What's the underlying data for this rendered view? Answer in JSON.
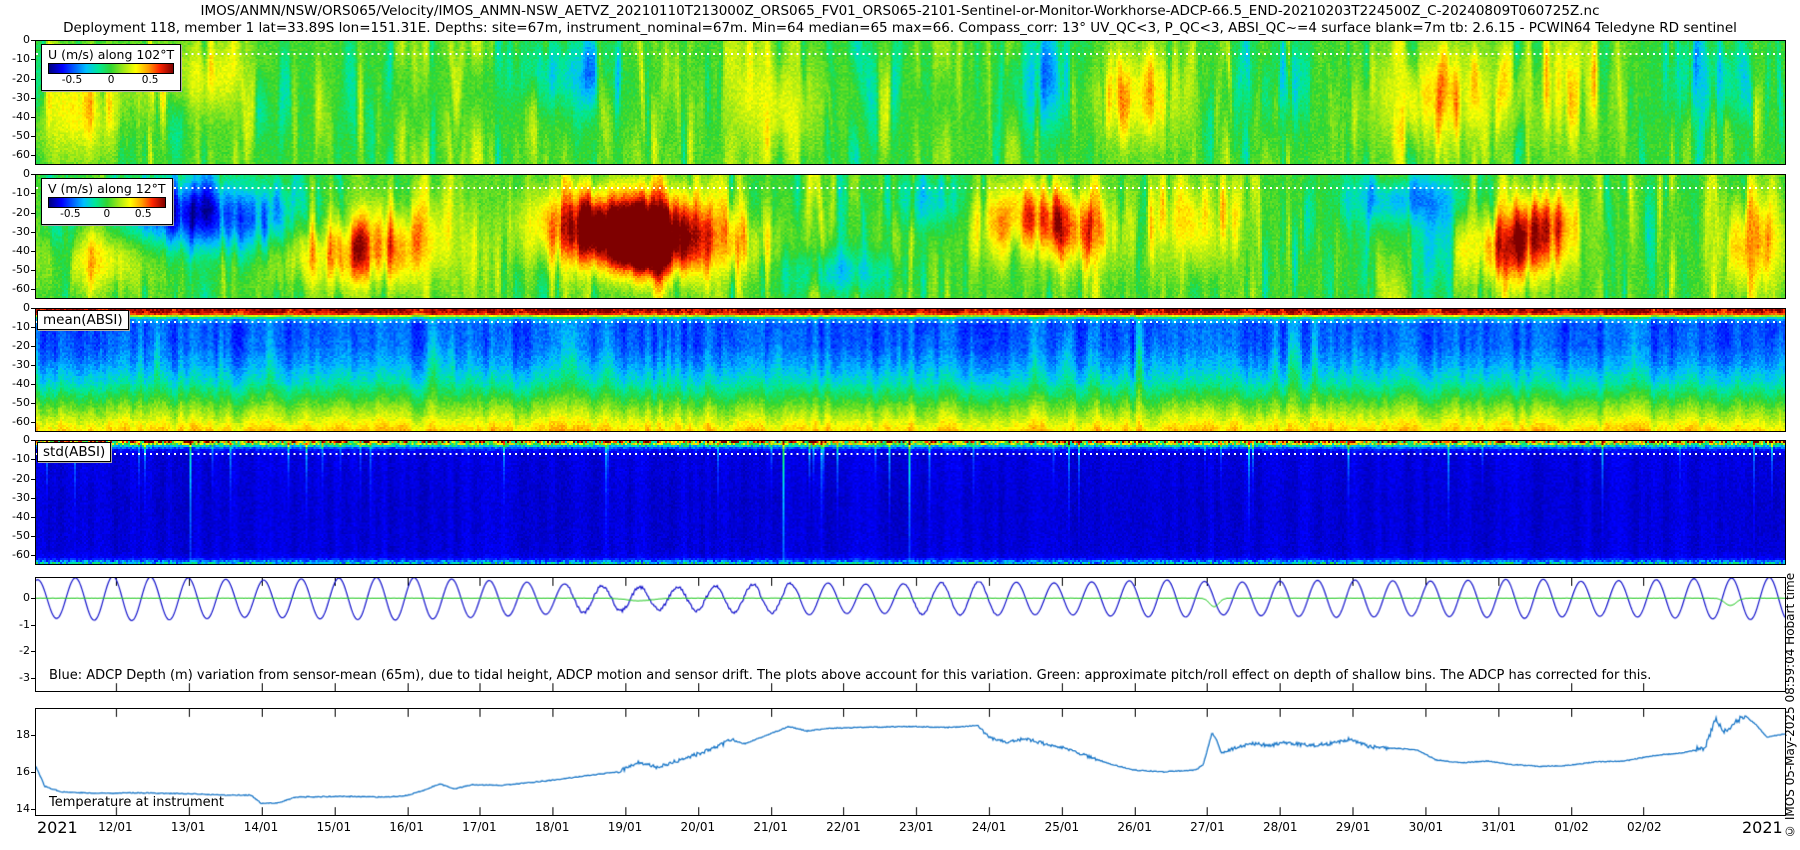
{
  "header": {
    "line1": "IMOS/ANMN/NSW/ORS065/Velocity/IMOS_ANMN-NSW_AETVZ_20210110T213000Z_ORS065_FV01_ORS065-2101-Sentinel-or-Monitor-Workhorse-ADCP-66.5_END-20210203T224500Z_C-20240809T060725Z.nc",
    "line2": "Deployment 118, member 1 lat=33.89S lon=151.31E. Depths: site=67m, instrument_nominal=67m. Min=64 median=65 max=66. Compass_corr: 13° UV_QC<3, P_QC<3, ABSI_QC~=4 surface blank=7m tb: 2.6.15 - PCWIN64 Teledyne RD sentinel"
  },
  "panels": {
    "u": {
      "legend_title": "U (m/s) along 102°T",
      "cb_ticks": [
        "-0.5",
        "0",
        "0.5"
      ]
    },
    "v": {
      "legend_title": "V (m/s) along 12°T",
      "cb_ticks": [
        "-0.5",
        "0",
        "0.5"
      ]
    },
    "mean_absi": {
      "label": "mean(ABSI)"
    },
    "std_absi": {
      "label": "std(ABSI)"
    },
    "depth": {
      "note": "Blue: ADCP Depth (m) variation from sensor-mean (65m), due to tidal height, ADCP motion and sensor drift. The plots above account for this variation. Green: approximate pitch/roll effect on depth of shallow bins. The ADCP has corrected for this."
    },
    "temp": {
      "label": "Temperature at instrument"
    }
  },
  "xaxis": {
    "year_left": "2021",
    "year_right": "2021",
    "dates": [
      "12/01",
      "13/01",
      "14/01",
      "15/01",
      "16/01",
      "17/01",
      "18/01",
      "19/01",
      "20/01",
      "21/01",
      "22/01",
      "23/01",
      "24/01",
      "25/01",
      "26/01",
      "27/01",
      "28/01",
      "29/01",
      "30/01",
      "31/01",
      "01/02",
      "02/02"
    ],
    "first_tick_day": 1.104,
    "total_days": 24.05
  },
  "credit": "© IMOS 05-May-2025 08:59:04 Hobart time",
  "chart_data": {
    "colormap": [
      [
        0,
        "#00007f"
      ],
      [
        0.11,
        "#0000ff"
      ],
      [
        0.3,
        "#00bfff"
      ],
      [
        0.4,
        "#00e896"
      ],
      [
        0.5,
        "#30d530"
      ],
      [
        0.6,
        "#9fe817"
      ],
      [
        0.7,
        "#ffff00"
      ],
      [
        0.8,
        "#ff9f00"
      ],
      [
        0.89,
        "#ff2500"
      ],
      [
        1,
        "#7f0000"
      ]
    ],
    "depth_axis": {
      "ticks": [
        [
          "0",
          0.0
        ],
        [
          "-10",
          0.154
        ],
        [
          "-20",
          0.308
        ],
        [
          "-30",
          0.462
        ],
        [
          "-40",
          0.615
        ],
        [
          "-50",
          0.769
        ],
        [
          "-60",
          0.923
        ]
      ],
      "range_m": [
        0,
        -65
      ]
    },
    "u": {
      "type": "heatmap",
      "units": "m/s",
      "direction_deg": 102,
      "domain": [
        -0.8,
        0.8
      ],
      "seed": 7,
      "base": 0.02,
      "col_amp": 0.26,
      "cell_amp": 0.05,
      "blank_line_depth": 0.105,
      "blobs": [
        [
          0.025,
          0.55,
          0.025,
          0.4,
          0.35
        ],
        [
          0.09,
          0.3,
          0.035,
          0.3,
          0.25
        ],
        [
          0.3,
          0.25,
          0.03,
          0.3,
          -0.3
        ],
        [
          0.42,
          0.5,
          0.03,
          0.4,
          0.25
        ],
        [
          0.578,
          0.3,
          0.018,
          0.45,
          -0.4
        ],
        [
          0.63,
          0.45,
          0.03,
          0.4,
          0.3
        ],
        [
          0.71,
          0.3,
          0.025,
          0.35,
          -0.25
        ],
        [
          0.8,
          0.45,
          0.035,
          0.45,
          0.35
        ],
        [
          0.875,
          0.35,
          0.025,
          0.5,
          0.3
        ],
        [
          0.955,
          0.3,
          0.02,
          0.4,
          -0.3
        ]
      ]
    },
    "v": {
      "type": "heatmap",
      "units": "m/s",
      "direction_deg": 12,
      "domain": [
        -0.8,
        0.8
      ],
      "seed": 13,
      "base": 0.03,
      "col_amp": 0.26,
      "cell_amp": 0.05,
      "blank_line_depth": 0.105,
      "blobs": [
        [
          0.035,
          0.7,
          0.03,
          0.25,
          0.3
        ],
        [
          0.075,
          0.3,
          0.03,
          0.28,
          -0.5
        ],
        [
          0.115,
          0.35,
          0.035,
          0.3,
          -0.45
        ],
        [
          0.175,
          0.65,
          0.04,
          0.3,
          0.45
        ],
        [
          0.21,
          0.5,
          0.03,
          0.35,
          0.3
        ],
        [
          0.3,
          0.45,
          0.025,
          0.35,
          0.4
        ],
        [
          0.335,
          0.42,
          0.028,
          0.3,
          0.95
        ],
        [
          0.345,
          0.65,
          0.02,
          0.2,
          0.5
        ],
        [
          0.365,
          0.5,
          0.022,
          0.35,
          0.6
        ],
        [
          0.405,
          0.55,
          0.025,
          0.3,
          0.35
        ],
        [
          0.46,
          0.8,
          0.035,
          0.2,
          -0.3
        ],
        [
          0.51,
          0.2,
          0.025,
          0.25,
          -0.3
        ],
        [
          0.57,
          0.35,
          0.03,
          0.3,
          0.55
        ],
        [
          0.6,
          0.5,
          0.02,
          0.3,
          0.35
        ],
        [
          0.66,
          0.35,
          0.025,
          0.4,
          0.35
        ],
        [
          0.78,
          0.18,
          0.03,
          0.22,
          -0.45
        ],
        [
          0.805,
          0.5,
          0.02,
          0.4,
          -0.2
        ],
        [
          0.845,
          0.6,
          0.028,
          0.3,
          0.65
        ],
        [
          0.862,
          0.35,
          0.018,
          0.25,
          0.4
        ],
        [
          0.98,
          0.55,
          0.02,
          0.4,
          0.45
        ]
      ]
    },
    "mean_absi": {
      "type": "heatmap",
      "domain": [
        0,
        1
      ],
      "seed": 3,
      "profile": [
        [
          0,
          0.97
        ],
        [
          0.03,
          0.92
        ],
        [
          0.045,
          0.7
        ],
        [
          0.06,
          0.42
        ],
        [
          0.08,
          0.26
        ],
        [
          0.12,
          0.19
        ],
        [
          0.3,
          0.2
        ],
        [
          0.45,
          0.26
        ],
        [
          0.6,
          0.36
        ],
        [
          0.72,
          0.47
        ],
        [
          0.82,
          0.57
        ],
        [
          0.9,
          0.64
        ],
        [
          0.96,
          0.7
        ],
        [
          1,
          0.74
        ]
      ],
      "col_amp": 0.06,
      "cell_amp": 0.035,
      "top_speckle": 0.08,
      "mid_streaks": 0.2,
      "blank_line_depth": 0.105
    },
    "std_absi": {
      "type": "heatmap",
      "domain": [
        0,
        1
      ],
      "seed": 5,
      "profile": [
        [
          0,
          0.75
        ],
        [
          0.02,
          0.55
        ],
        [
          0.035,
          0.3
        ],
        [
          0.06,
          0.13
        ],
        [
          0.1,
          0.085
        ],
        [
          0.5,
          0.075
        ],
        [
          0.9,
          0.08
        ],
        [
          0.96,
          0.1
        ],
        [
          1,
          0.16
        ]
      ],
      "col_amp": 0.02,
      "cell_amp": 0.02,
      "top_speckle": 0.4,
      "bottom_speckle": 0.3,
      "streak_cols": true,
      "blank_line_depth": 0.105
    },
    "depth_variation": {
      "type": "line",
      "ylim": [
        0.8,
        -3.53
      ],
      "yticks": [
        [
          "0",
          0.183
        ],
        [
          "-1",
          0.415
        ],
        [
          "-2",
          0.647
        ],
        [
          "-3",
          0.879
        ]
      ],
      "tide_cycles_per_day": 1.932,
      "phase": 1.3,
      "amplitude_envelope": [
        [
          0,
          0.72
        ],
        [
          1,
          0.85
        ],
        [
          2,
          0.8
        ],
        [
          3,
          0.7
        ],
        [
          4,
          0.78
        ],
        [
          5,
          0.82
        ],
        [
          6,
          0.72
        ],
        [
          7,
          0.6
        ],
        [
          7.7,
          0.5
        ],
        [
          8.5,
          0.42
        ],
        [
          9.2,
          0.46
        ],
        [
          10,
          0.55
        ],
        [
          10.7,
          0.62
        ],
        [
          11.3,
          0.55
        ],
        [
          12,
          0.58
        ],
        [
          13,
          0.65
        ],
        [
          14,
          0.6
        ],
        [
          15,
          0.68
        ],
        [
          15.7,
          0.72
        ],
        [
          16.3,
          0.62
        ],
        [
          17,
          0.66
        ],
        [
          18,
          0.72
        ],
        [
          19,
          0.66
        ],
        [
          20,
          0.72
        ],
        [
          20.6,
          0.76
        ],
        [
          21.2,
          0.66
        ],
        [
          22,
          0.7
        ],
        [
          22.8,
          0.76
        ],
        [
          24.05,
          0.82
        ]
      ],
      "noisy_ranges": [
        [
          7.3,
          10.5,
          0.12
        ],
        [
          11.8,
          13.2,
          0.06
        ]
      ],
      "line_color": "#1414cc",
      "green_line": {
        "base": 0.02,
        "dips": [
          [
            8.3,
            0.25,
            -0.1
          ],
          [
            16.2,
            0.09,
            -0.33
          ],
          [
            23.3,
            0.11,
            -0.28
          ]
        ],
        "color": "#22c822"
      }
    },
    "temperature": {
      "type": "line",
      "ylim": [
        19.46,
        13.62
      ],
      "yticks": [
        [
          "18",
          0.25
        ],
        [
          "16",
          0.593
        ],
        [
          "14",
          0.935
        ]
      ],
      "line_color": "#1c78c8",
      "keypoints": [
        [
          0,
          16.3
        ],
        [
          0.12,
          15.2
        ],
        [
          0.35,
          14.9
        ],
        [
          0.8,
          14.82
        ],
        [
          1.4,
          14.85
        ],
        [
          2.0,
          14.8
        ],
        [
          2.6,
          14.72
        ],
        [
          2.95,
          14.72
        ],
        [
          3.1,
          14.25
        ],
        [
          3.35,
          14.3
        ],
        [
          3.55,
          14.6
        ],
        [
          4.2,
          14.65
        ],
        [
          4.8,
          14.6
        ],
        [
          5.1,
          14.7
        ],
        [
          5.35,
          15.0
        ],
        [
          5.55,
          15.35
        ],
        [
          5.75,
          15.05
        ],
        [
          6.0,
          15.3
        ],
        [
          6.4,
          15.25
        ],
        [
          7.0,
          15.5
        ],
        [
          7.5,
          15.75
        ],
        [
          8.0,
          16.0
        ],
        [
          8.3,
          16.5
        ],
        [
          8.55,
          16.25
        ],
        [
          9.0,
          16.85
        ],
        [
          9.3,
          17.25
        ],
        [
          9.55,
          17.75
        ],
        [
          9.75,
          17.55
        ],
        [
          10.1,
          18.1
        ],
        [
          10.35,
          18.5
        ],
        [
          10.6,
          18.25
        ],
        [
          10.9,
          18.4
        ],
        [
          11.4,
          18.45
        ],
        [
          12.0,
          18.5
        ],
        [
          12.55,
          18.45
        ],
        [
          12.95,
          18.55
        ],
        [
          13.1,
          17.9
        ],
        [
          13.35,
          17.6
        ],
        [
          13.6,
          17.85
        ],
        [
          13.9,
          17.5
        ],
        [
          14.2,
          17.25
        ],
        [
          14.5,
          16.8
        ],
        [
          14.8,
          16.4
        ],
        [
          15.1,
          16.1
        ],
        [
          15.5,
          16.0
        ],
        [
          15.95,
          16.1
        ],
        [
          16.05,
          16.4
        ],
        [
          16.17,
          18.15
        ],
        [
          16.24,
          17.7
        ],
        [
          16.3,
          17.0
        ],
        [
          16.5,
          17.35
        ],
        [
          16.7,
          17.55
        ],
        [
          16.95,
          17.45
        ],
        [
          17.2,
          17.6
        ],
        [
          17.5,
          17.45
        ],
        [
          17.8,
          17.55
        ],
        [
          18.05,
          17.8
        ],
        [
          18.35,
          17.35
        ],
        [
          18.7,
          17.3
        ],
        [
          19.0,
          17.2
        ],
        [
          19.25,
          16.65
        ],
        [
          19.6,
          16.5
        ],
        [
          19.95,
          16.6
        ],
        [
          20.3,
          16.4
        ],
        [
          20.7,
          16.3
        ],
        [
          21.05,
          16.35
        ],
        [
          21.45,
          16.55
        ],
        [
          21.85,
          16.6
        ],
        [
          22.25,
          16.9
        ],
        [
          22.65,
          17.05
        ],
        [
          22.95,
          17.35
        ],
        [
          23.1,
          18.95
        ],
        [
          23.2,
          18.2
        ],
        [
          23.35,
          18.65
        ],
        [
          23.5,
          19.1
        ],
        [
          23.65,
          18.6
        ],
        [
          23.8,
          17.9
        ],
        [
          24.05,
          18.1
        ]
      ],
      "spiky_ranges": [
        [
          8,
          9.6,
          0.1
        ],
        [
          13.0,
          14.6,
          0.08
        ],
        [
          16.3,
          18.6,
          0.09
        ],
        [
          22.8,
          23.5,
          0.15
        ]
      ]
    }
  }
}
